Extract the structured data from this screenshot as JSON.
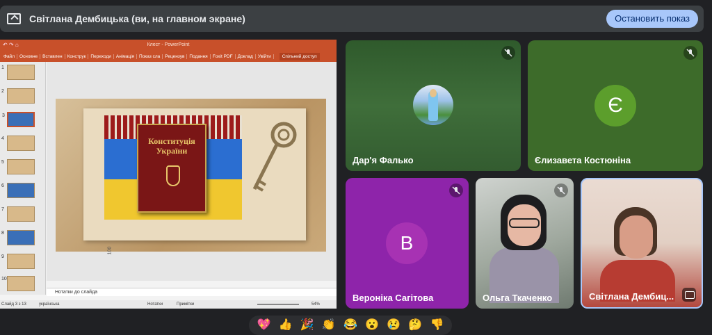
{
  "presenting": {
    "title": "Світлана Дембицька (ви, на главном экране)",
    "stop_label": "Остановить показ"
  },
  "ppt": {
    "window_title": "Клест - PowerPoint",
    "quick_access": "↶ ↷ ⌂",
    "ribbon": [
      "Файл",
      "Основне",
      "Вставлен",
      "Конструк",
      "Переходи",
      "Анімація",
      "Показ сла",
      "Рецензув",
      "Подання",
      "Foxit PDF",
      "Доклад",
      "Увійти"
    ],
    "share_label": "Спільний доступ",
    "thumbnails": [
      1,
      2,
      3,
      4,
      5,
      6,
      7,
      8,
      9,
      10
    ],
    "active_slide": 3,
    "slide": {
      "book_line1": "Конституція",
      "book_line2": "України",
      "ruler_label": "100"
    },
    "notes_placeholder": "Нотатки до слайда",
    "status": {
      "slide_of": "Слайд 3 з 13",
      "language": "українська",
      "notes": "Нотатки",
      "comments": "Примітки",
      "zoom": "54%"
    }
  },
  "participants": [
    {
      "name": "Дар'я Фалько",
      "muted": true,
      "type": "photo"
    },
    {
      "name": "Єлизавета Костюніна",
      "muted": true,
      "type": "letter",
      "letter": "Є",
      "color": "#5c9e2c"
    },
    {
      "name": "Вероніка Сагітова",
      "muted": true,
      "type": "letter",
      "letter": "В",
      "color": "#a732b3"
    },
    {
      "name": "Ольга Ткаченко",
      "muted": true,
      "type": "camera"
    },
    {
      "name": "Світлана Дембиц...",
      "muted": false,
      "type": "camera"
    }
  ],
  "colors": {
    "tile_green": "#3d6b2a",
    "tile_purple": "#8e24aa",
    "accent_blue": "#a8c7fa",
    "ppt_orange": "#c8502a"
  },
  "reactions": [
    "💖",
    "👍",
    "🎉",
    "👏",
    "😂",
    "😮",
    "😢",
    "🤔",
    "👎"
  ]
}
